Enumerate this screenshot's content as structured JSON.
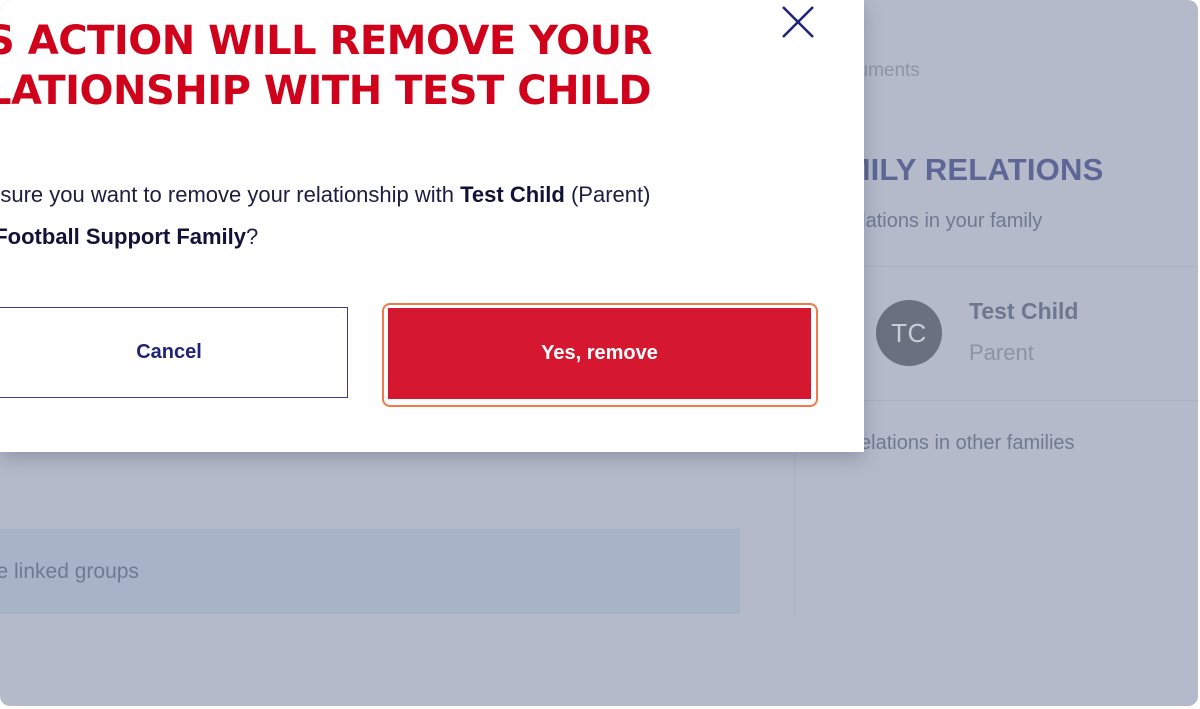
{
  "modal": {
    "title": "S ACTION WILL REMOVE YOUR LATIONSHIP WITH TEST CHILD",
    "body": {
      "line1_prefix": "u sure you want to remove your relationship with ",
      "child_name": "Test Child",
      "line1_suffix": " (Parent)",
      "family_name": "yFootball Support Family",
      "line2_suffix": "?"
    },
    "cancel_label": "Cancel",
    "confirm_label": "Yes, remove",
    "close_icon": "close-icon"
  },
  "background": {
    "documents_label": "cuments",
    "family_title": "AMILY RELATIONS",
    "family_subtitle": "elations in your family",
    "member": {
      "initials": "TC",
      "name": "Test Child",
      "role": "Parent"
    },
    "other_families_label": "elations in other families",
    "linked_groups_label": "ve linked groups"
  },
  "colors": {
    "title_red": "#d0021b",
    "confirm_button": "#d61730",
    "focus_ring": "#f07a4a",
    "cancel_border": "#3a3f8a",
    "overlay": "#b4bac9"
  }
}
